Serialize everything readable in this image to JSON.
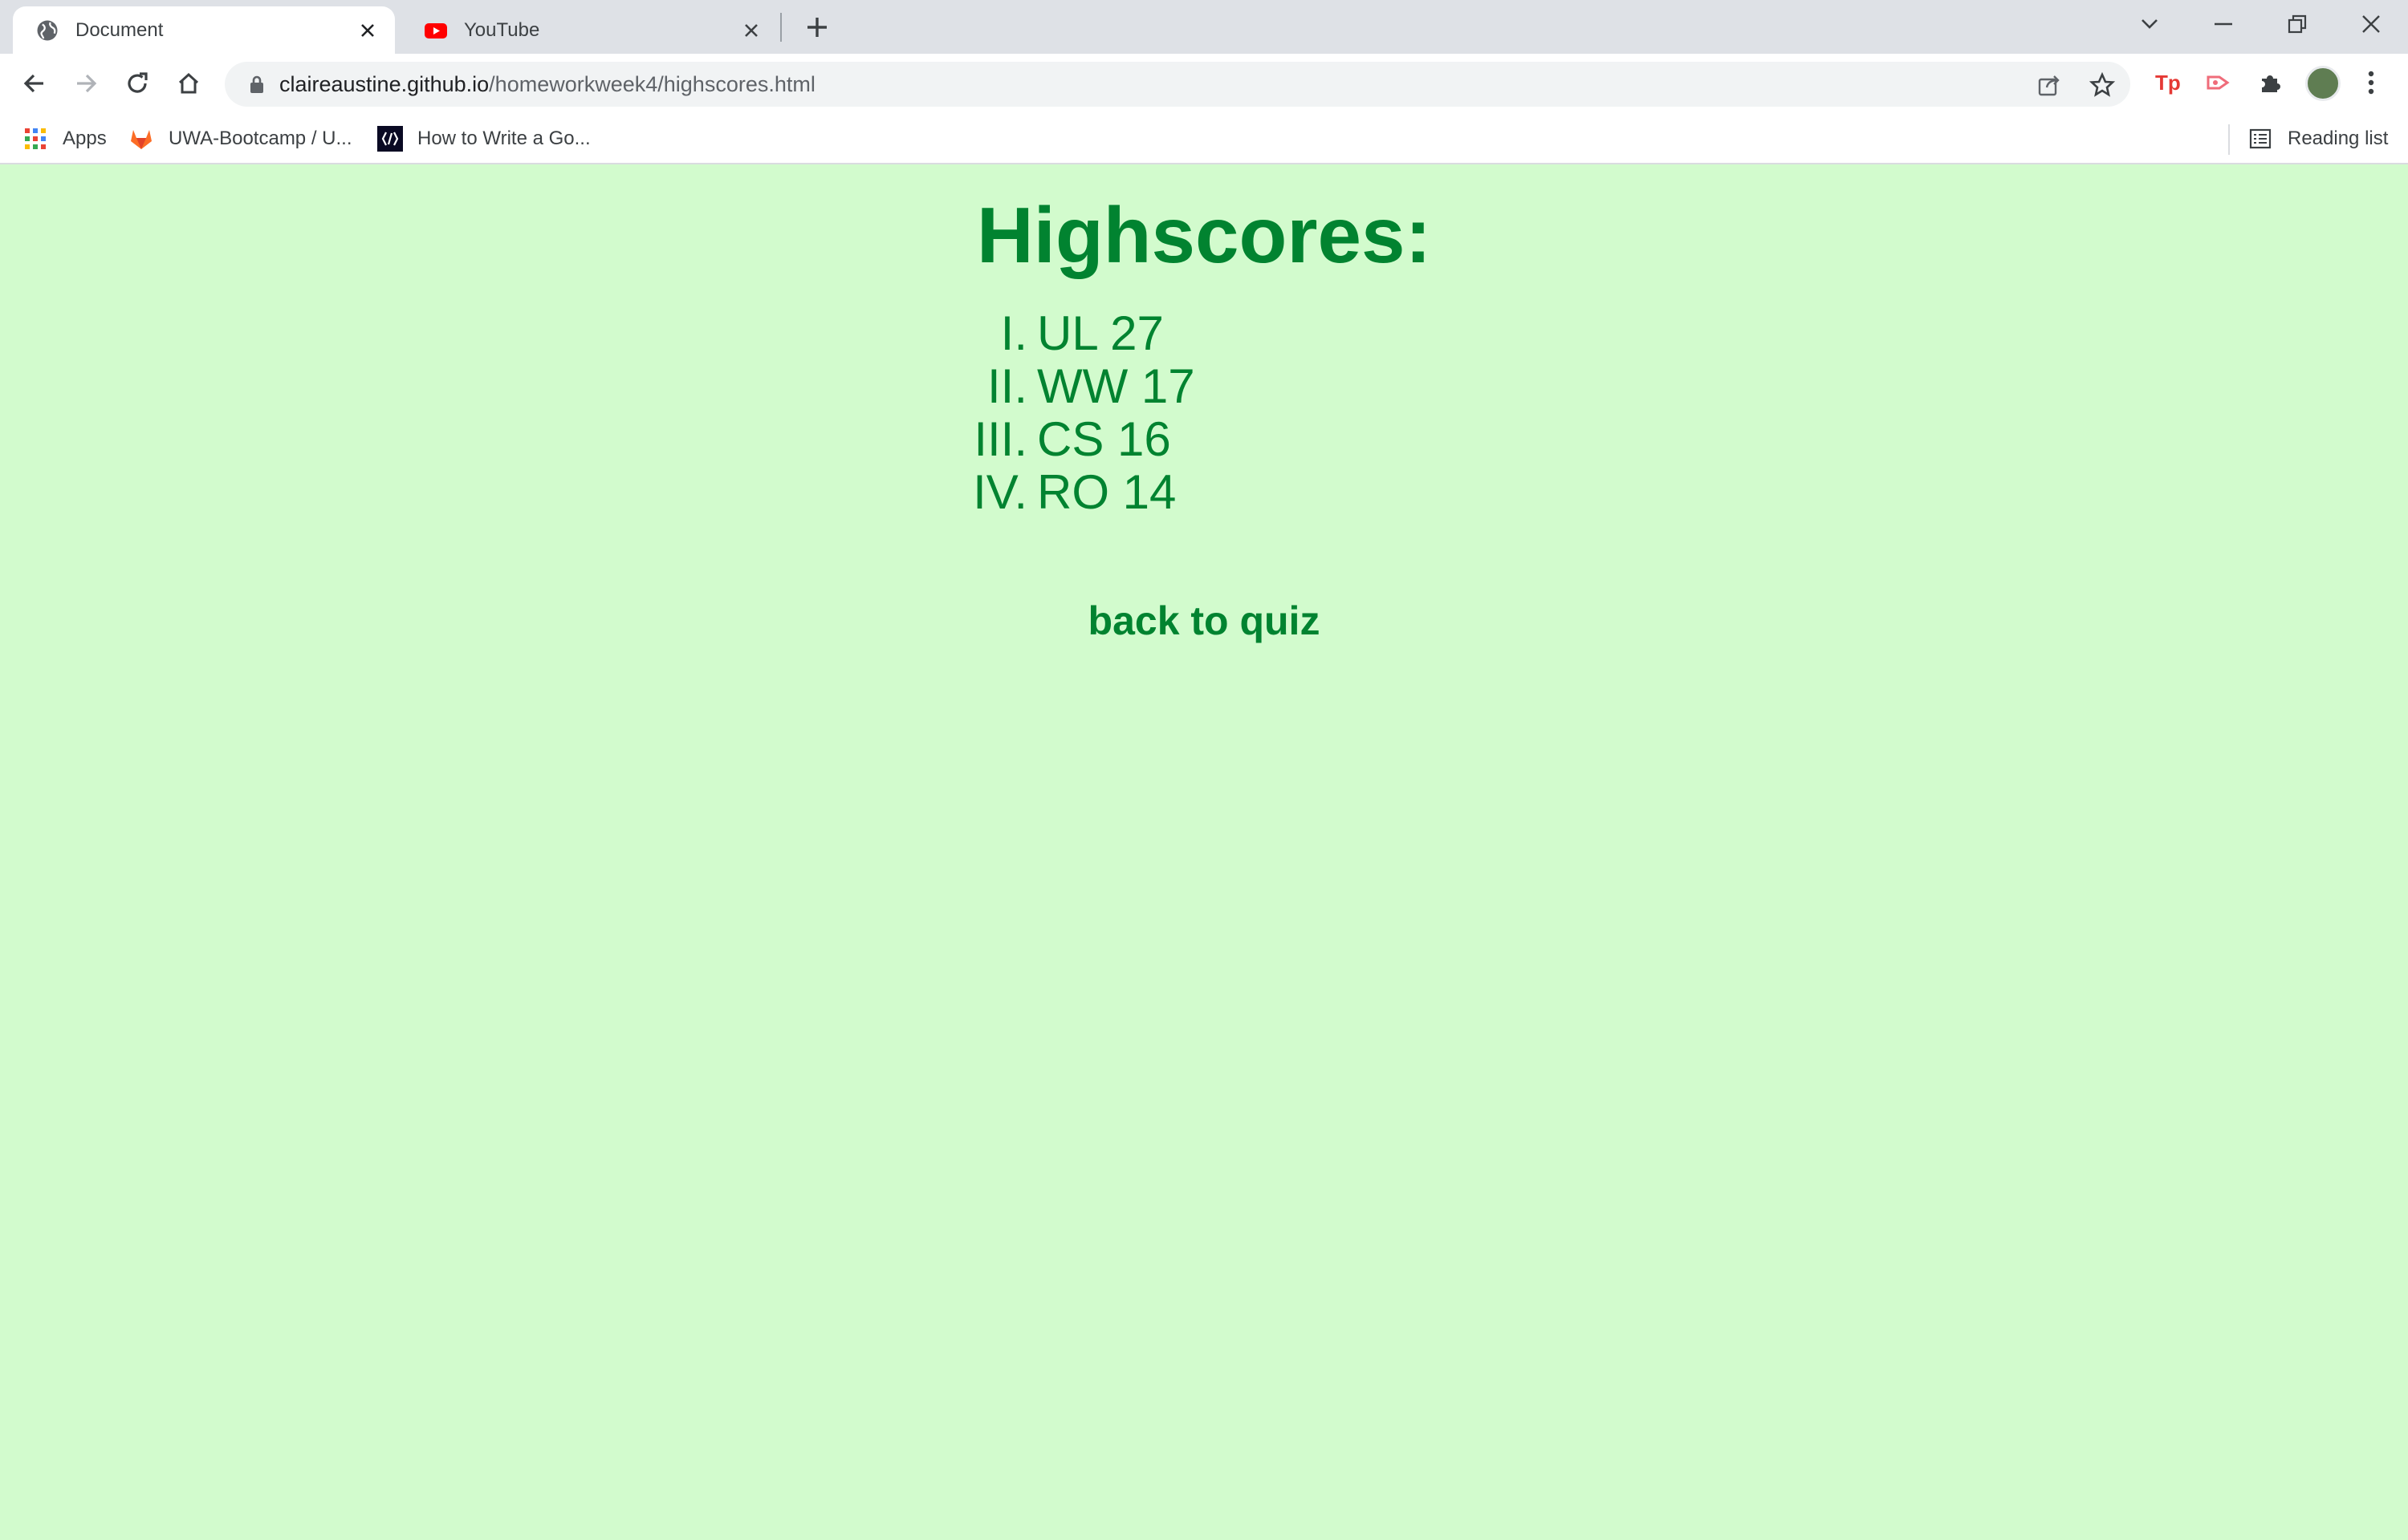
{
  "browser": {
    "tabs": [
      {
        "title": "Document",
        "favicon": "globe-icon",
        "active": true
      },
      {
        "title": "YouTube",
        "favicon": "youtube-icon",
        "active": false
      }
    ],
    "url": {
      "host": "claireaustine.github.io",
      "path": "/homeworkweek4/highscores.html"
    },
    "bookmarks": [
      {
        "label": "Apps",
        "icon": "apps-grid-icon"
      },
      {
        "label": "UWA-Bootcamp / U...",
        "icon": "gitlab-icon"
      },
      {
        "label": "How to Write a Go...",
        "icon": "site-logo-icon"
      }
    ],
    "reading_list_label": "Reading list"
  },
  "page": {
    "heading": "Highscores:",
    "scores": [
      {
        "rank": "I.",
        "entry": "UL 27"
      },
      {
        "rank": "II.",
        "entry": "WW 17"
      },
      {
        "rank": "III.",
        "entry": "CS 16"
      },
      {
        "rank": "IV.",
        "entry": "RO 14"
      }
    ],
    "back_link": "back to quiz"
  },
  "colors": {
    "background": "#d2fbcd",
    "text": "#018330"
  }
}
